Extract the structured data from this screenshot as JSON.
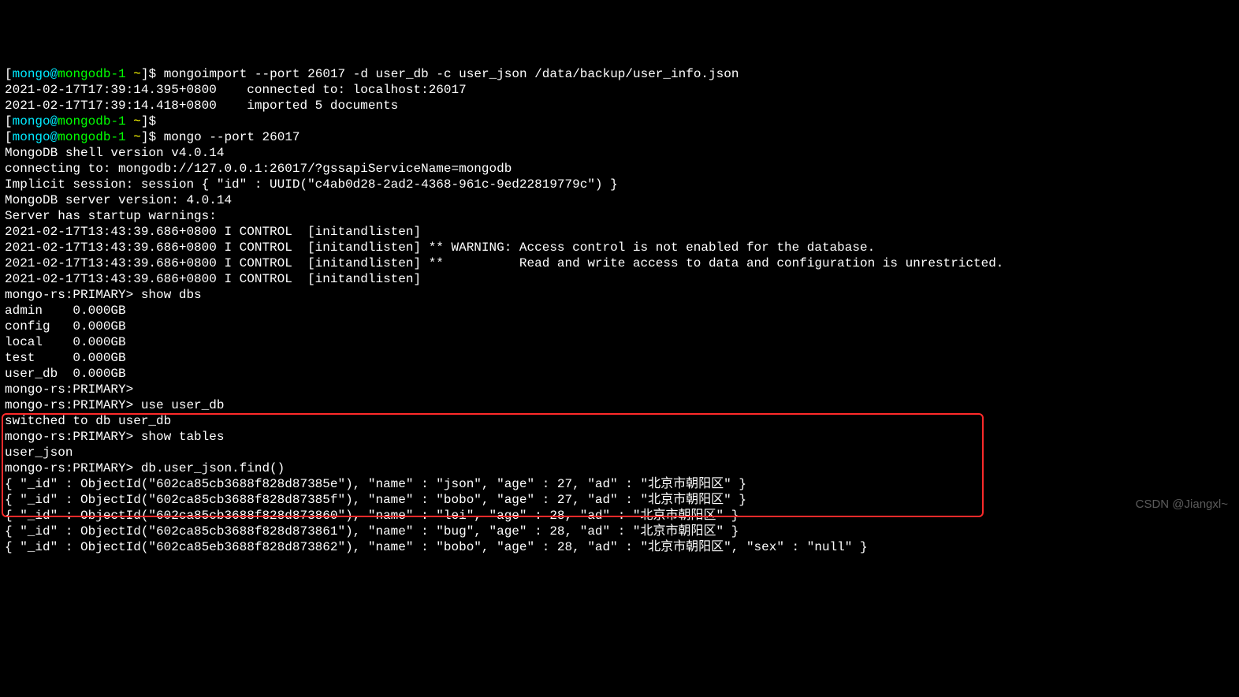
{
  "prompt": {
    "user": "mongo",
    "host": "mongodb-1",
    "path": "~",
    "symbol": "$"
  },
  "cmd1": "mongoimport --port 26017 -d user_db -c user_json /data/backup/user_info.json",
  "out1a": "2021-02-17T17:39:14.395+0800    connected to: localhost:26017",
  "out1b": "2021-02-17T17:39:14.418+0800    imported 5 documents",
  "cmd2_blank": "",
  "cmd3": "mongo --port 26017",
  "shell_ver": "MongoDB shell version v4.0.14",
  "connecting": "connecting to: mongodb://127.0.0.1:26017/?gssapiServiceName=mongodb",
  "session": "Implicit session: session { \"id\" : UUID(\"c4ab0d28-2ad2-4368-961c-9ed22819779c\") }",
  "server_ver": "MongoDB server version: 4.0.14",
  "warn_hdr": "Server has startup warnings: ",
  "w1": "2021-02-17T13:43:39.686+0800 I CONTROL  [initandlisten] ",
  "w2": "2021-02-17T13:43:39.686+0800 I CONTROL  [initandlisten] ** WARNING: Access control is not enabled for the database.",
  "w3": "2021-02-17T13:43:39.686+0800 I CONTROL  [initandlisten] **          Read and write access to data and configuration is unrestricted.",
  "w4": "2021-02-17T13:43:39.686+0800 I CONTROL  [initandlisten] ",
  "mongo_prompt": "mongo-rs:PRIMARY> ",
  "show_dbs": "show dbs",
  "dbs": {
    "admin": "admin    0.000GB",
    "config": "config   0.000GB",
    "local": "local    0.000GB",
    "test": "test     0.000GB",
    "user_db": "user_db  0.000GB"
  },
  "use_user_db": "use user_db",
  "switched": "switched to db user_db",
  "show_tables": "show tables",
  "tables_out": "user_json",
  "find_cmd": "db.user_json.find()",
  "docs": [
    "{ \"_id\" : ObjectId(\"602ca85cb3688f828d87385e\"), \"name\" : \"json\", \"age\" : 27, \"ad\" : \"北京市朝阳区\" }",
    "{ \"_id\" : ObjectId(\"602ca85cb3688f828d87385f\"), \"name\" : \"bobo\", \"age\" : 27, \"ad\" : \"北京市朝阳区\" }",
    "{ \"_id\" : ObjectId(\"602ca85cb3688f828d873860\"), \"name\" : \"lei\", \"age\" : 28, \"ad\" : \"北京市朝阳区\" }",
    "{ \"_id\" : ObjectId(\"602ca85cb3688f828d873861\"), \"name\" : \"bug\", \"age\" : 28, \"ad\" : \"北京市朝阳区\" }",
    "{ \"_id\" : ObjectId(\"602ca85eb3688f828d873862\"), \"name\" : \"bobo\", \"age\" : 28, \"ad\" : \"北京市朝阳区\", \"sex\" : \"null\" }"
  ],
  "watermark": "CSDN @Jiangxl~"
}
